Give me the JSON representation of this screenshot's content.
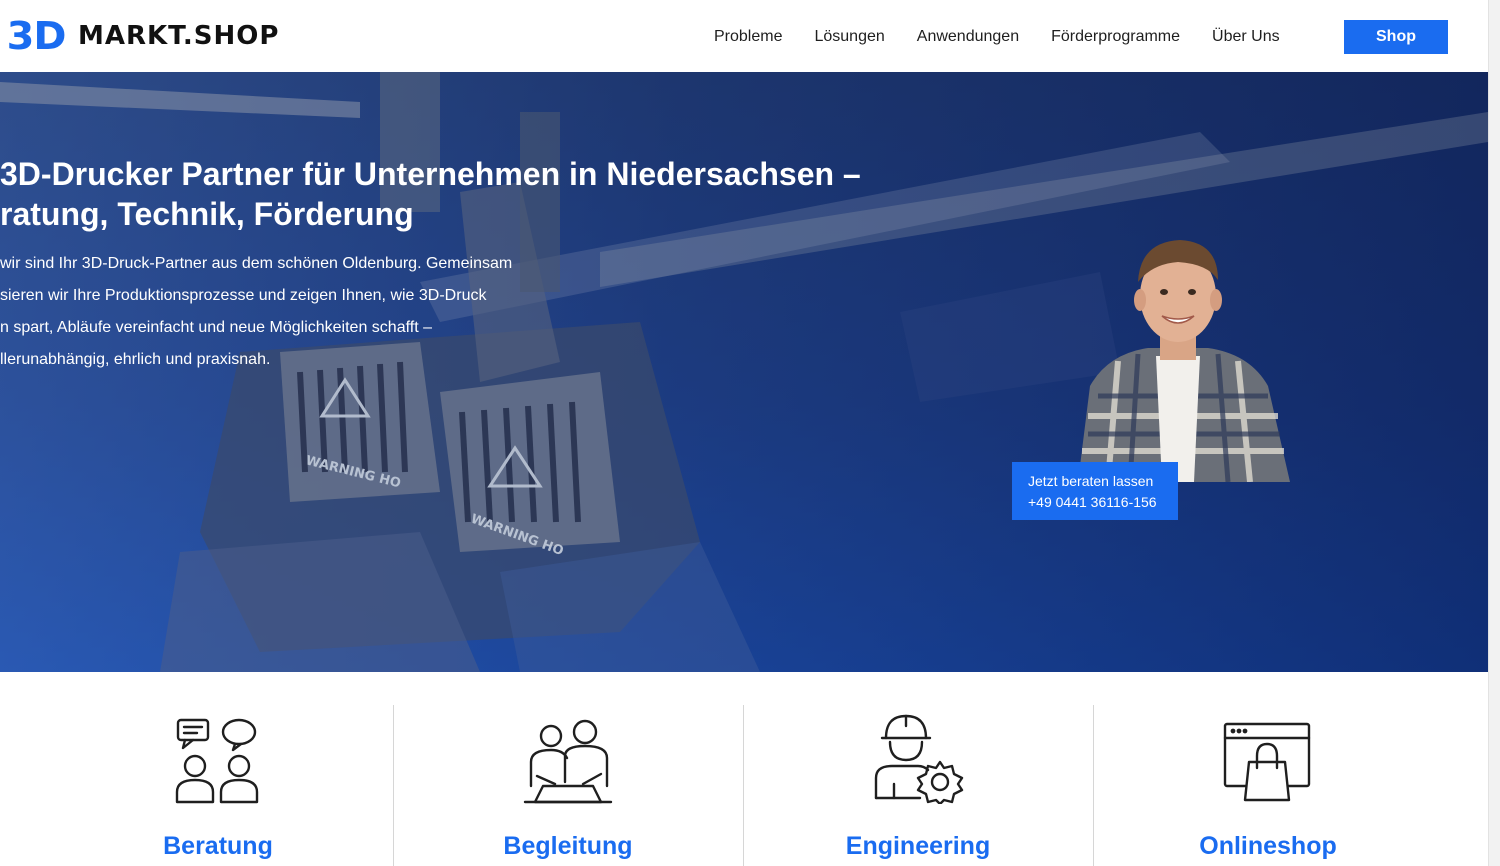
{
  "header": {
    "logo_mark": "3D",
    "logo_text": "MARKT.SHOP",
    "nav": [
      {
        "label": "Probleme"
      },
      {
        "label": "Lösungen"
      },
      {
        "label": "Anwendungen"
      },
      {
        "label": "Förderprogramme"
      },
      {
        "label": "Über Uns"
      }
    ],
    "shop_label": "Shop"
  },
  "hero": {
    "title_line1": " 3D-Drucker Partner für Unternehmen in Niedersachsen –",
    "title_line2": "ratung, Technik, Förderung",
    "text_lines": [
      " wir sind Ihr 3D-Druck-Partner aus dem schönen Oldenburg. Gemeinsam",
      "sieren wir Ihre Produktionsprozesse und zeigen Ihnen, wie 3D-Druck",
      "n spart, Abläufe vereinfacht und neue Möglichkeiten schafft –",
      "llerunabhängig, ehrlich und praxisnah."
    ],
    "printer_warning_1": "WARNING HO",
    "printer_warning_2": "WARNING HO",
    "cta_line1": "Jetzt beraten lassen",
    "cta_line2": "+49 0441 36116-156"
  },
  "features": [
    {
      "label": "Beratung",
      "icon": "consulting-chat-icon"
    },
    {
      "label": "Begleitung",
      "icon": "team-support-icon"
    },
    {
      "label": "Engineering",
      "icon": "engineer-gear-icon"
    },
    {
      "label": "Onlineshop",
      "icon": "browser-shopping-bag-icon"
    }
  ],
  "colors": {
    "accent": "#1a6cf0",
    "text_dark": "#1f1f1f"
  }
}
